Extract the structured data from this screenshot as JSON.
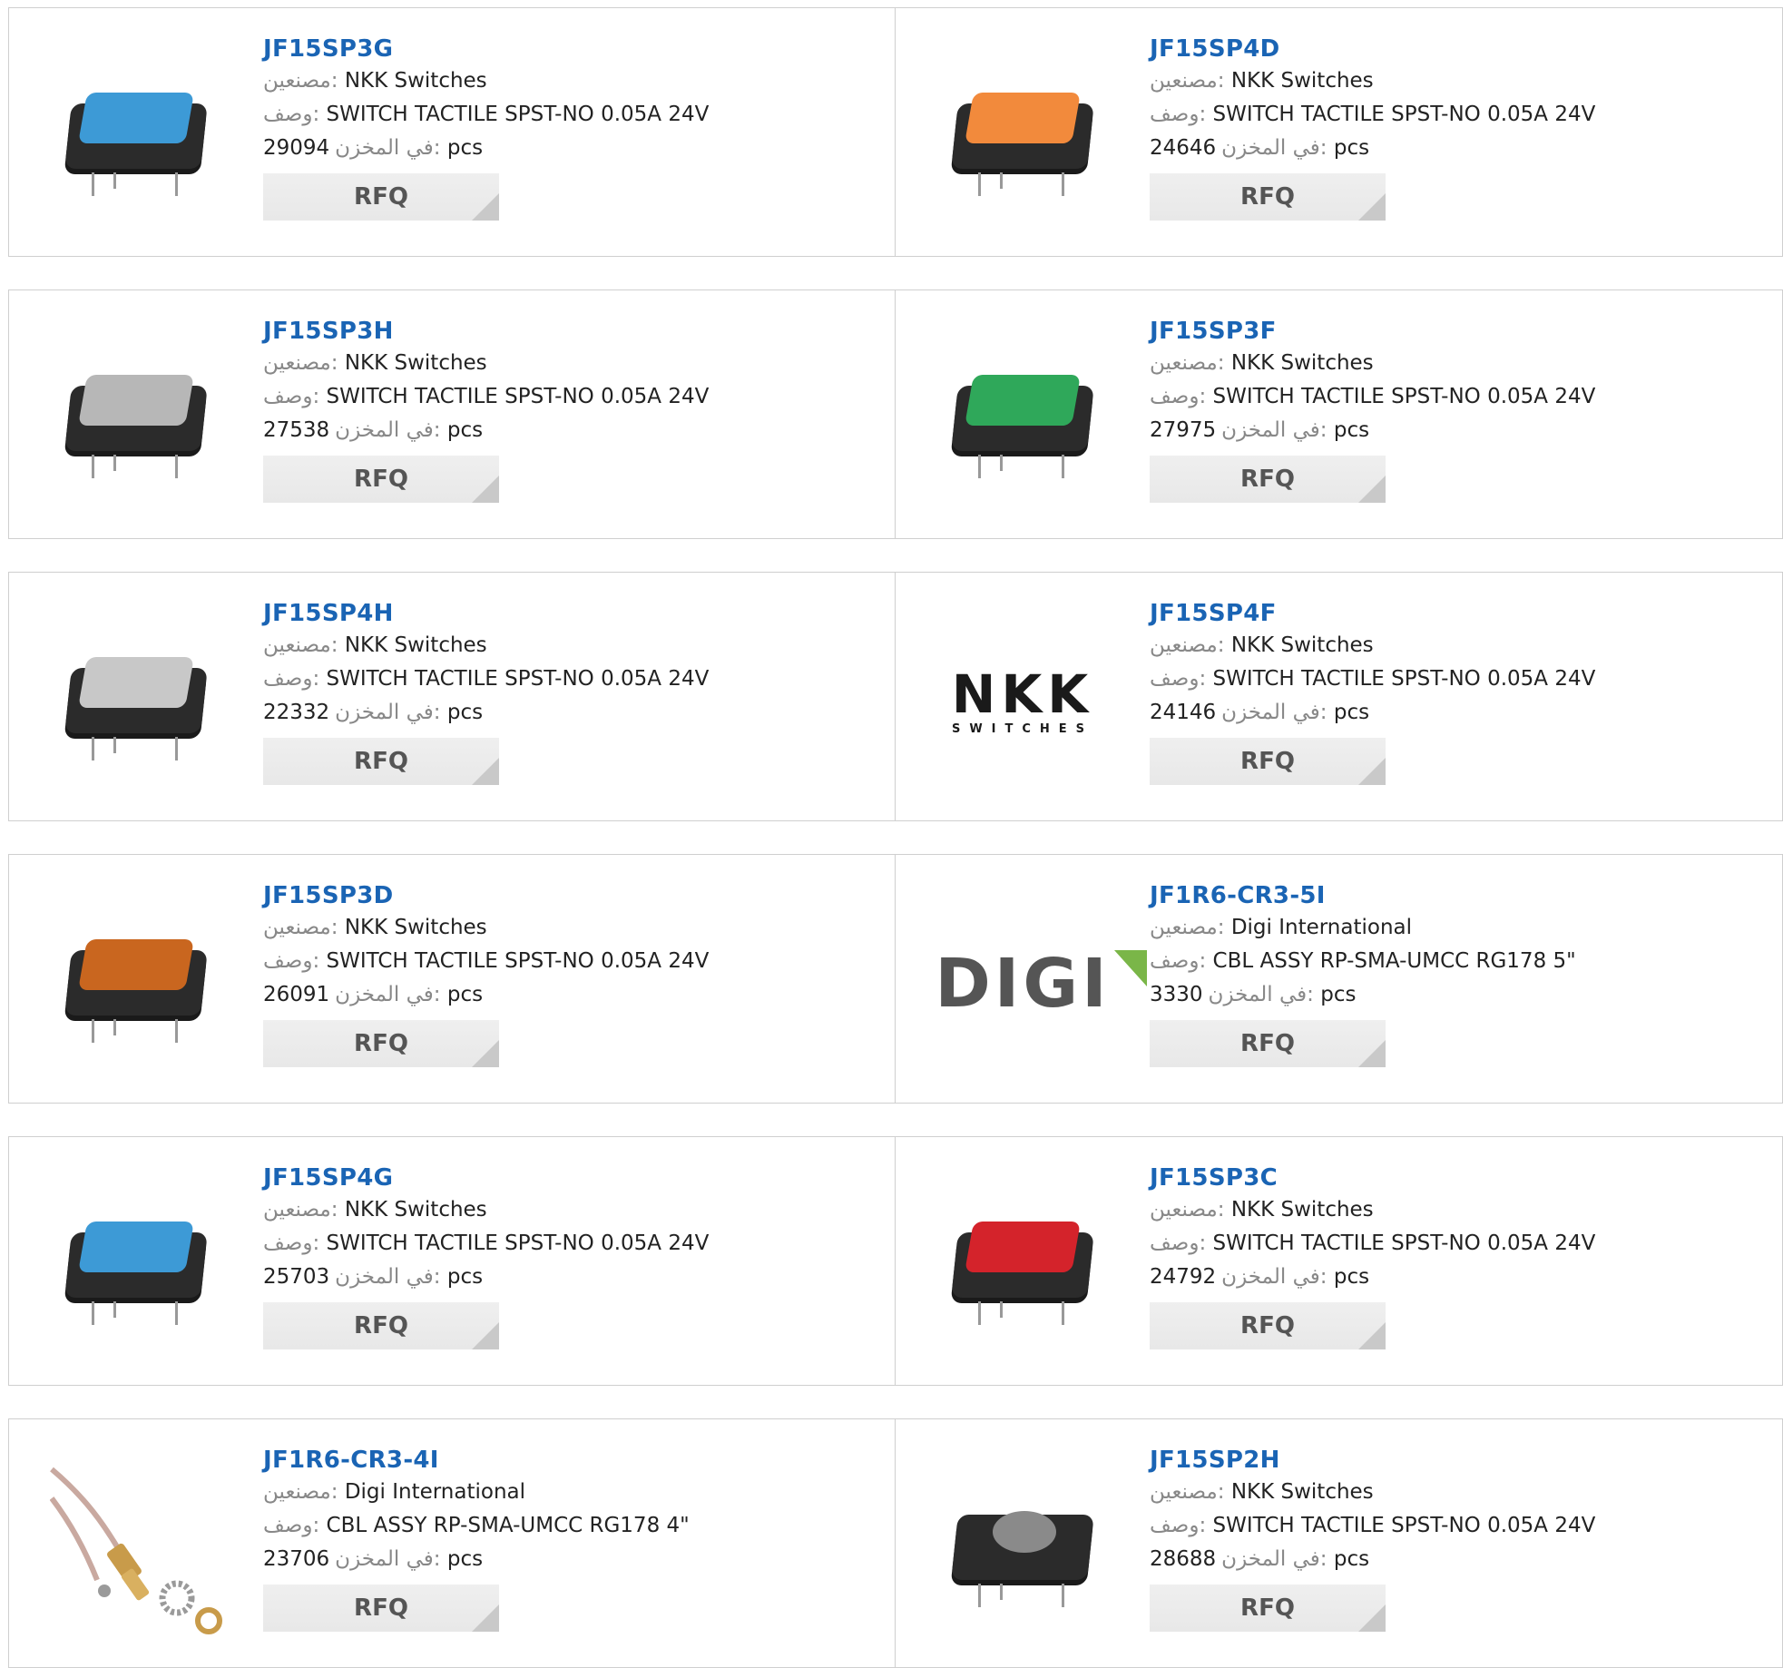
{
  "labels": {
    "manufacturer": "مصنعين:",
    "description": "وصف:",
    "stock": "في المخزن:",
    "unit": "pcs",
    "rfq": "RFQ"
  },
  "logos": {
    "nkk_big": "NKK",
    "nkk_small": "SWITCHES",
    "digi": "DIGI"
  },
  "products": [
    {
      "part": "JF15SP3G",
      "manufacturer": "NKK Switches",
      "description": "SWITCH TACTILE SPST-NO 0.05A 24V",
      "stock": "29094",
      "image": "switch-blue",
      "cap_color": "#3d9ad6"
    },
    {
      "part": "JF15SP4D",
      "manufacturer": "NKK Switches",
      "description": "SWITCH TACTILE SPST-NO 0.05A 24V",
      "stock": "24646",
      "image": "switch-orange",
      "cap_color": "#f28a3c"
    },
    {
      "part": "JF15SP3H",
      "manufacturer": "NKK Switches",
      "description": "SWITCH TACTILE SPST-NO 0.05A 24V",
      "stock": "27538",
      "image": "switch-gray",
      "cap_color": "#b7b7b7"
    },
    {
      "part": "JF15SP3F",
      "manufacturer": "NKK Switches",
      "description": "SWITCH TACTILE SPST-NO 0.05A 24V",
      "stock": "27975",
      "image": "switch-green",
      "cap_color": "#2fa85a"
    },
    {
      "part": "JF15SP4H",
      "manufacturer": "NKK Switches",
      "description": "SWITCH TACTILE SPST-NO 0.05A 24V",
      "stock": "22332",
      "image": "switch-lightgray",
      "cap_color": "#c8c8c8"
    },
    {
      "part": "JF15SP4F",
      "manufacturer": "NKK Switches",
      "description": "SWITCH TACTILE SPST-NO 0.05A 24V",
      "stock": "24146",
      "image": "nkk-logo",
      "cap_color": ""
    },
    {
      "part": "JF15SP3D",
      "manufacturer": "NKK Switches",
      "description": "SWITCH TACTILE SPST-NO 0.05A 24V",
      "stock": "26091",
      "image": "switch-darkorange",
      "cap_color": "#c9661f"
    },
    {
      "part": "JF1R6-CR3-5I",
      "manufacturer": "Digi International",
      "description": "CBL ASSY RP-SMA-UMCC RG178 5\"",
      "stock": "3330",
      "image": "digi-logo",
      "cap_color": ""
    },
    {
      "part": "JF15SP4G",
      "manufacturer": "NKK Switches",
      "description": "SWITCH TACTILE SPST-NO 0.05A 24V",
      "stock": "25703",
      "image": "switch-blue",
      "cap_color": "#3d9ad6"
    },
    {
      "part": "JF15SP3C",
      "manufacturer": "NKK Switches",
      "description": "SWITCH TACTILE SPST-NO 0.05A 24V",
      "stock": "24792",
      "image": "switch-red",
      "cap_color": "#d4232b"
    },
    {
      "part": "JF1R6-CR3-4I",
      "manufacturer": "Digi International",
      "description": "CBL ASSY RP-SMA-UMCC RG178 4\"",
      "stock": "23706",
      "image": "cable-assembly",
      "cap_color": ""
    },
    {
      "part": "JF15SP2H",
      "manufacturer": "NKK Switches",
      "description": "SWITCH TACTILE SPST-NO 0.05A 24V",
      "stock": "28688",
      "image": "switch-round-gray",
      "cap_color": "#8a8a8a"
    }
  ]
}
